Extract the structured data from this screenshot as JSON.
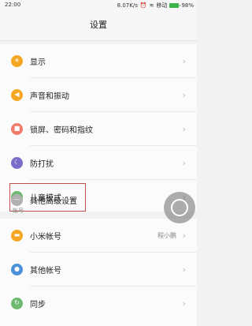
{
  "status": {
    "time": "22:00",
    "speed": "8.07K/s",
    "carrier": "移动",
    "battery": "98%"
  },
  "header": {
    "title": "设置"
  },
  "items_main": [
    {
      "label": "显示",
      "icon": "display-icon",
      "color": "#f5a623"
    },
    {
      "label": "声音和振动",
      "icon": "speaker-icon",
      "color": "#f5a623"
    },
    {
      "label": "锁屏、密码和指纹",
      "icon": "lock-icon",
      "color": "#f07b6b"
    },
    {
      "label": "防打扰",
      "icon": "moon-icon",
      "color": "#7b6cc9"
    },
    {
      "label": "儿童模式",
      "icon": "child-mode-icon",
      "color": "#6fb86f"
    },
    {
      "label": "其他高级设置",
      "icon": "more-icon",
      "color": "#b0b0b0"
    }
  ],
  "section_accounts": {
    "header": "帐号",
    "items": [
      {
        "label": "小米帐号",
        "icon": "mi-account-icon",
        "color": "#f5a623",
        "value": "程小鹏"
      },
      {
        "label": "其他帐号",
        "icon": "person-icon",
        "color": "#4a90d9"
      },
      {
        "label": "同步",
        "icon": "sync-icon",
        "color": "#6fb86f"
      }
    ]
  },
  "chevron": "›"
}
